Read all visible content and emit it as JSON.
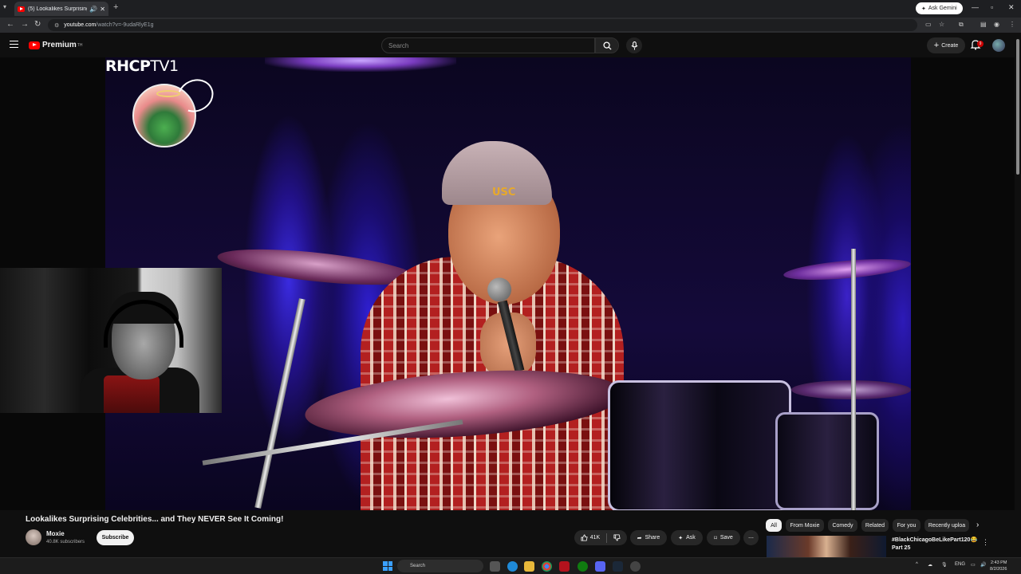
{
  "browser": {
    "tab_title": "(5) Lookalikes Surprising Ce",
    "ask_gemini": "Ask Gemini",
    "url_host": "youtube.com",
    "url_path": "/watch?v=-9udaRlyE1g"
  },
  "youtube_header": {
    "logo_text": "Premium",
    "logo_country": "TH",
    "search_placeholder": "Search",
    "create_label": "Create",
    "notification_count": "9"
  },
  "video_overlay": {
    "channel_watermark_bold": "RHCP",
    "channel_watermark_light": "TV1",
    "cap_text": "USC"
  },
  "video": {
    "title": "Lookalikes Surprising Celebrities... and They NEVER See It Coming!",
    "channel_name": "Moxie",
    "subscribers": "40.8K subscribers",
    "subscribe_label": "Subscribe",
    "like_count": "41K",
    "share_label": "Share",
    "ask_label": "Ask",
    "save_label": "Save"
  },
  "chips": [
    "All",
    "From Moxie",
    "Comedy",
    "Related",
    "For you",
    "Recently uploa"
  ],
  "recommendation": {
    "title": "#BlackChicagoBeLikePart120😂",
    "subtitle": "Part 25"
  },
  "taskbar": {
    "search_placeholder": "Search",
    "language": "ENG",
    "time": "2:43 PM",
    "date": "8/2/2026"
  },
  "colors": {
    "youtube_red": "#ff0000",
    "background": "#0f0f0f",
    "chip_bg": "#272727"
  }
}
